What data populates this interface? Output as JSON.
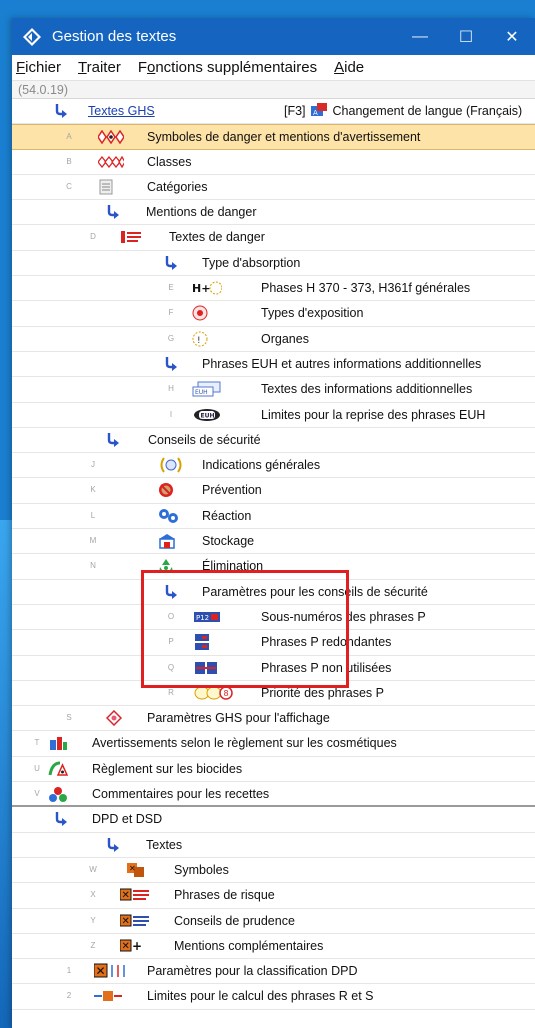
{
  "window": {
    "title": "Gestion des textes",
    "controls": {
      "minimize": "—",
      "maximize": "☐",
      "close": "✕"
    }
  },
  "menu": [
    {
      "key": "F",
      "rest": "ichier"
    },
    {
      "key": "T",
      "rest": "raiter"
    },
    {
      "pre": "F",
      "key": "o",
      "rest": "nctions supplémentaires"
    },
    {
      "key": "A",
      "rest": "ide"
    }
  ],
  "version": "(54.0.19)",
  "header_row": {
    "label": "Textes GHS",
    "shortcut": "[F3]",
    "lang_label": "Changement de langue (Français)"
  },
  "rows": [
    {
      "id": "A",
      "letter": "A",
      "label": "Symboles de danger et mentions d'avertissement",
      "icon": "hazard-symbols-icon",
      "selected": true
    },
    {
      "id": "B",
      "letter": "B",
      "label": "Classes",
      "icon": "classes-icon"
    },
    {
      "id": "C",
      "letter": "C",
      "label": "Catégories",
      "icon": "categories-icon"
    },
    {
      "id": "g1",
      "letter": "",
      "label": "Mentions de danger",
      "group": true
    },
    {
      "id": "D",
      "letter": "D",
      "label": "Textes de danger",
      "icon": "danger-texts-icon"
    },
    {
      "id": "g2",
      "letter": "",
      "label": "Type d'absorption",
      "group": true
    },
    {
      "id": "E",
      "letter": "E",
      "label": "Phases H 370 - 373, H361f générales",
      "icon": "h-phases-icon"
    },
    {
      "id": "F",
      "letter": "F",
      "label": "Types d'exposition",
      "icon": "exposure-types-icon"
    },
    {
      "id": "G",
      "letter": "G",
      "label": "Organes",
      "icon": "organs-icon"
    },
    {
      "id": "g3",
      "letter": "",
      "label": "Phrases EUH et autres informations additionnelles",
      "group": true
    },
    {
      "id": "H",
      "letter": "H",
      "label": "Textes des informations additionnelles",
      "icon": "additional-info-icon"
    },
    {
      "id": "I",
      "letter": "I",
      "label": "Limites pour la reprise des phrases EUH",
      "icon": "euh-limits-icon"
    },
    {
      "id": "g4",
      "letter": "",
      "label": "Conseils de sécurité",
      "group": true
    },
    {
      "id": "J",
      "letter": "J",
      "label": "Indications générales",
      "icon": "general-indications-icon"
    },
    {
      "id": "K",
      "letter": "K",
      "label": "Prévention",
      "icon": "prevention-icon"
    },
    {
      "id": "L",
      "letter": "L",
      "label": "Réaction",
      "icon": "reaction-icon"
    },
    {
      "id": "M",
      "letter": "M",
      "label": "Stockage",
      "icon": "storage-icon"
    },
    {
      "id": "N",
      "letter": "N",
      "label": "Élimination",
      "icon": "disposal-icon"
    },
    {
      "id": "g5",
      "letter": "",
      "label": "Paramètres pour les conseils de sécurité",
      "group": true
    },
    {
      "id": "O",
      "letter": "O",
      "label": "Sous-numéros des phrases P",
      "icon": "sub-numbers-icon"
    },
    {
      "id": "P",
      "letter": "P",
      "label": "Phrases P redondantes",
      "icon": "redundant-p-icon"
    },
    {
      "id": "Q",
      "letter": "Q",
      "label": "Phrases P non utilisées",
      "icon": "unused-p-icon"
    },
    {
      "id": "R",
      "letter": "R",
      "label": "Priorité des phrases P",
      "icon": "p-priority-icon"
    },
    {
      "id": "S",
      "letter": "S",
      "label": "Paramètres GHS pour l'affichage",
      "icon": "ghs-display-icon"
    },
    {
      "id": "T",
      "letter": "T",
      "label": "Avertissements selon le règlement sur les cosmétiques",
      "icon": "cosmetics-icon"
    },
    {
      "id": "U",
      "letter": "U",
      "label": "Règlement sur les biocides",
      "icon": "biocides-icon"
    },
    {
      "id": "V",
      "letter": "V",
      "label": "Commentaires pour les recettes",
      "icon": "recipe-comments-icon"
    },
    {
      "id": "g6",
      "letter": "",
      "label": "DPD et DSD",
      "group": true
    },
    {
      "id": "g7",
      "letter": "",
      "label": "Textes",
      "group": true
    },
    {
      "id": "W",
      "letter": "W",
      "label": "Symboles",
      "icon": "symbols-icon"
    },
    {
      "id": "X",
      "letter": "X",
      "label": "Phrases de risque",
      "icon": "risk-phrases-icon"
    },
    {
      "id": "Y",
      "letter": "Y",
      "label": "Conseils de prudence",
      "icon": "prudence-icon"
    },
    {
      "id": "Z",
      "letter": "Z",
      "label": "Mentions complémentaires",
      "icon": "complementary-icon"
    },
    {
      "id": "1",
      "letter": "1",
      "label": "Paramètres pour la classification DPD",
      "icon": "dpd-params-icon"
    },
    {
      "id": "2",
      "letter": "2",
      "label": "Limites pour le calcul des phrases R et S",
      "icon": "rs-limits-icon"
    }
  ]
}
